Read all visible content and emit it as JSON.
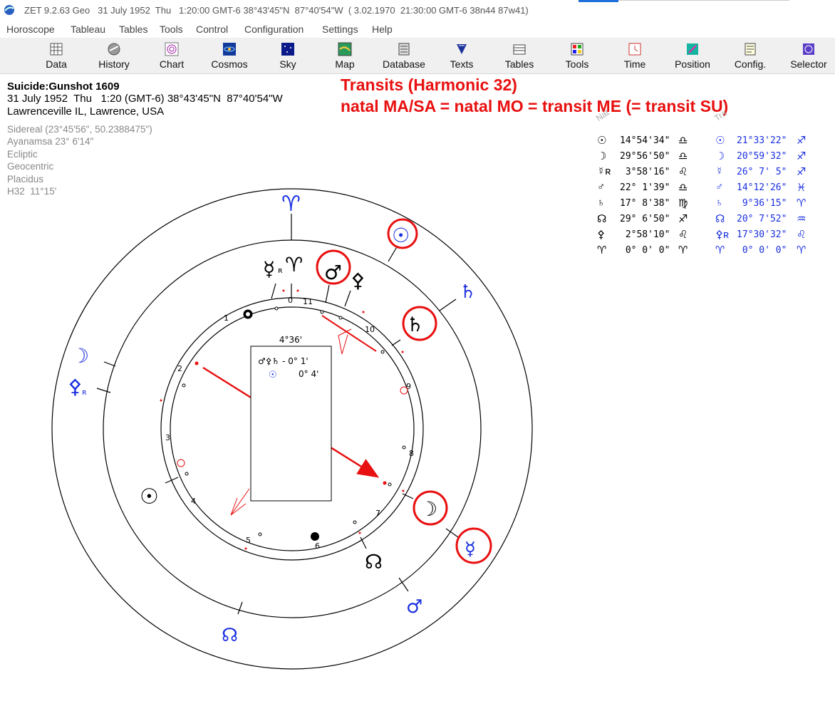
{
  "window": {
    "title": "ZET 9.2.63 Geo   31 July 1952  Thu   1:20:00 GMT-6 38°43'45\"N  87°40'54\"W  ( 3.02.1970  21:30:00 GMT-6 38n44 87w41)"
  },
  "menu": [
    "Horoscope",
    "Tableau",
    "Tables",
    "Tools",
    "Control",
    "Configuration",
    "Settings",
    "Help"
  ],
  "toolbar": [
    {
      "label": "Data",
      "icon": "data-grid-icon"
    },
    {
      "label": "History",
      "icon": "history-icon"
    },
    {
      "label": "Chart",
      "icon": "chart-wheel-icon"
    },
    {
      "label": "Cosmos",
      "icon": "cosmos-icon"
    },
    {
      "label": "Sky",
      "icon": "sky-icon"
    },
    {
      "label": "Map",
      "icon": "map-icon"
    },
    {
      "label": "Database",
      "icon": "database-icon"
    },
    {
      "label": "Texts",
      "icon": "texts-icon"
    },
    {
      "label": "Tables",
      "icon": "tables-icon"
    },
    {
      "label": "Tools",
      "icon": "tools-icon"
    },
    {
      "label": "Time",
      "icon": "time-icon"
    },
    {
      "label": "Position",
      "icon": "position-icon"
    },
    {
      "label": "Config.",
      "icon": "config-icon"
    },
    {
      "label": "Selector",
      "icon": "selector-icon"
    }
  ],
  "info": {
    "name": "Suicide:Gunshot 1609",
    "datetime": "31 July 1952  Thu   1:20 (GMT-6) 38°43'45\"N  87°40'54\"W",
    "place": "Lawrenceville IL, Lawrence, USA",
    "settings": [
      "Sidereal (23°45'56\", 50.2388475\")",
      "Ayanamsa 23° 6'14\"",
      "Ecliptic",
      "Geocentric",
      "Placidus",
      "H32  11°15'"
    ]
  },
  "annotation": {
    "line1": "Transits (Harmonic 32)",
    "line2": "natal MA/SA = natal MO = transit ME (= transit SU)"
  },
  "colors": {
    "natal": "#000000",
    "transit": "#1a2fe0",
    "highlight": "#e81010"
  },
  "table": {
    "natal_header": "Nat",
    "transit_header": "Tra",
    "natal": [
      {
        "glyph": "☉",
        "value": "14°54'34\"",
        "sign": "♎"
      },
      {
        "glyph": "☽",
        "value": "29°56'50\"",
        "sign": "♎"
      },
      {
        "glyph": "☿ʀ",
        "value": " 3°58'16\"",
        "sign": "♌"
      },
      {
        "glyph": "♂",
        "value": "22° 1'39\"",
        "sign": "♎"
      },
      {
        "glyph": "♄",
        "value": "17° 8'38\"",
        "sign": "♍"
      },
      {
        "glyph": "☊",
        "value": "29° 6'50\"",
        "sign": "♐"
      },
      {
        "glyph": "⚴",
        "value": " 2°58'10\"",
        "sign": "♌"
      },
      {
        "glyph": "♈",
        "value": " 0° 0' 0\"",
        "sign": "♈"
      }
    ],
    "transit": [
      {
        "glyph": "☉",
        "value": "21°33'22\"",
        "sign": "♐"
      },
      {
        "glyph": "☽",
        "value": "20°59'32\"",
        "sign": "♐"
      },
      {
        "glyph": "☿",
        "value": "26° 7' 5\"",
        "sign": "♐"
      },
      {
        "glyph": "♂",
        "value": "14°12'26\"",
        "sign": "♓"
      },
      {
        "glyph": "♄",
        "value": " 9°36'15\"",
        "sign": "♈"
      },
      {
        "glyph": "☊",
        "value": "20° 7'52\"",
        "sign": "♒"
      },
      {
        "glyph": "⚴ʀ",
        "value": "17°30'32\"",
        "sign": "♌"
      },
      {
        "glyph": "♈",
        "value": " 0° 0' 0\"",
        "sign": "♈"
      }
    ]
  },
  "wheel": {
    "houses": [
      "1",
      "2",
      "3",
      "4",
      "5",
      "6",
      "7",
      "8",
      "9",
      "10",
      "11",
      "0"
    ],
    "center_box": {
      "title": "4°36'",
      "row1": "♂⚴♄ - 0° 1'",
      "row2_glyph": "☉",
      "row2_value": "0° 4'"
    },
    "natal_glyphs": [
      "☿",
      "ʀ",
      "♈",
      "♂",
      "⚴"
    ],
    "transit_glyphs": [
      "♈",
      "☉",
      "♄",
      "☽",
      "⚴",
      "ʀ",
      "☉",
      "☽",
      "☿",
      "♂",
      "☊",
      "♂"
    ],
    "node_glyph": "☊"
  }
}
